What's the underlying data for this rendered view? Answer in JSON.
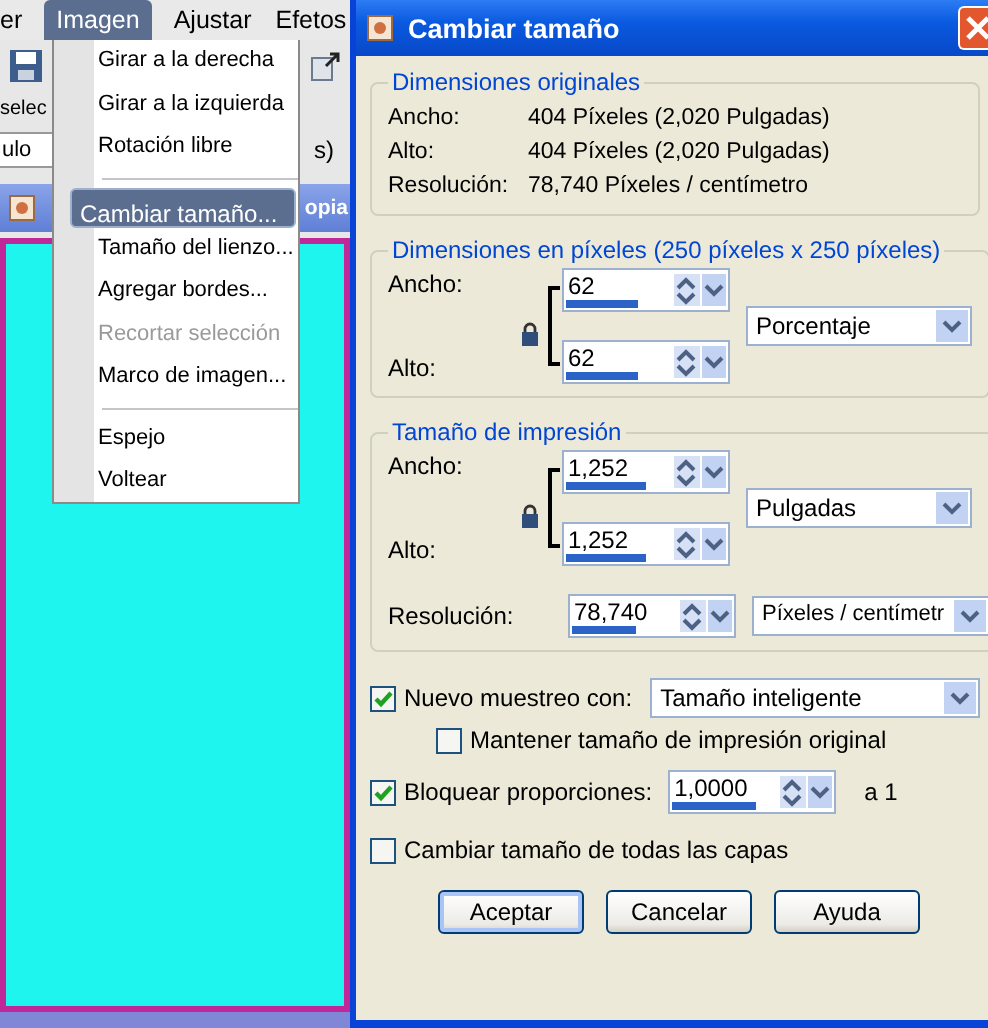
{
  "app": {
    "menubar": [
      {
        "label": "er",
        "selected": false
      },
      {
        "label": "Imagen",
        "selected": true
      },
      {
        "label": "Ajustar",
        "selected": false
      },
      {
        "label": "Efetos",
        "selected": false
      }
    ],
    "toolbar": {
      "label": "selec",
      "field_value": "ulo",
      "suffix": "s)"
    },
    "document": {
      "title_end": "opia"
    }
  },
  "menu": {
    "items": [
      {
        "kind": "item",
        "label": "Girar a la derecha",
        "selected": false,
        "disabled": false
      },
      {
        "kind": "item",
        "label": "Girar a la izquierda",
        "selected": false,
        "disabled": false
      },
      {
        "kind": "item",
        "label": "Rotación libre",
        "selected": false,
        "disabled": false
      },
      {
        "kind": "separator"
      },
      {
        "kind": "item",
        "label": "Cambiar tamaño...",
        "selected": true,
        "disabled": false
      },
      {
        "kind": "item",
        "label": "Tamaño del lienzo...",
        "selected": false,
        "disabled": false
      },
      {
        "kind": "item",
        "label": "Agregar bordes...",
        "selected": false,
        "disabled": false
      },
      {
        "kind": "item",
        "label": "Recortar selección",
        "selected": false,
        "disabled": true
      },
      {
        "kind": "item",
        "label": "Marco de imagen...",
        "selected": false,
        "disabled": false
      },
      {
        "kind": "separator"
      },
      {
        "kind": "item",
        "label": "Espejo",
        "selected": false,
        "disabled": false
      },
      {
        "kind": "item",
        "label": "Voltear",
        "selected": false,
        "disabled": false
      }
    ]
  },
  "dialog": {
    "title": "Cambiar tamaño",
    "original": {
      "legend": "Dimensiones originales",
      "rows": [
        {
          "label": "Ancho:",
          "value": "404 Píxeles (2,020 Pulgadas)"
        },
        {
          "label": "Alto:",
          "value": "404 Píxeles (2,020 Pulgadas)"
        },
        {
          "label": "Resolución:",
          "value": "78,740 Píxeles / centímetro"
        }
      ]
    },
    "pixel_dimensions": {
      "legend": "Dimensiones en píxeles (250 píxeles x 250 píxeles)",
      "fields": [
        {
          "label": "Ancho:",
          "value": "62",
          "level": 0.45
        },
        {
          "label": "Alto:",
          "value": "62",
          "level": 0.45
        }
      ],
      "unit": "Porcentaje"
    },
    "print_size": {
      "legend": "Tamaño de impresión",
      "fields": [
        {
          "label": "Ancho:",
          "value": "1,252",
          "level": 0.5
        },
        {
          "label": "Alto:",
          "value": "1,252",
          "level": 0.5
        }
      ],
      "unit": "Pulgadas",
      "resolution": {
        "label": "Resolución:",
        "value": "78,740",
        "level": 0.4,
        "unit": "Píxeles / centímetr"
      }
    },
    "options": [
      {
        "kind": "checkbox_select",
        "label": "Nuevo muestreo con:",
        "checked": true,
        "value": "Tamaño inteligente",
        "children": [
          {
            "kind": "checkbox",
            "label": "Mantener tamaño de impresión original",
            "checked": false
          }
        ]
      },
      {
        "kind": "checkbox_spin",
        "label": "Bloquear proporciones:",
        "checked": true,
        "value": "1,0000",
        "level": 0.52,
        "suffix": "a 1"
      },
      {
        "kind": "checkbox",
        "label": "Cambiar tamaño de todas las capas",
        "checked": false
      }
    ],
    "buttons": [
      {
        "label": "Aceptar",
        "default": true
      },
      {
        "label": "Cancelar",
        "default": false
      },
      {
        "label": "Ayuda",
        "default": false
      }
    ]
  }
}
